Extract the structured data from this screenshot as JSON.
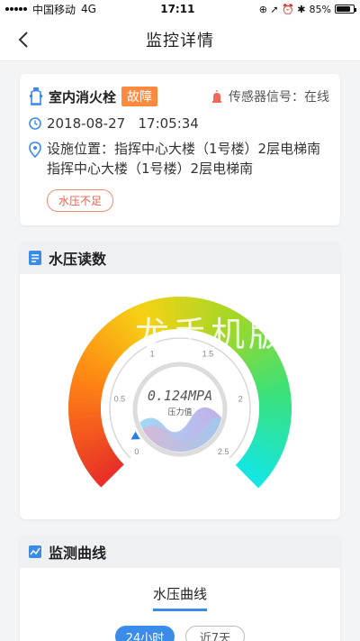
{
  "status_bar": {
    "carrier": "中国移动",
    "network": "4G",
    "time": "17:11",
    "battery": "85%",
    "battery_level": 0.85
  },
  "nav": {
    "title": "监控详情"
  },
  "device": {
    "name": "室内消火栓",
    "status_badge": "故障",
    "sensor_label": "传感器信号：在线",
    "datetime": "2018-08-27   17:05:34",
    "location": "设施位置：指挥中心大楼（1号楼）2层电梯南指挥中心大楼（1号楼）2层电梯南",
    "alert_tag": "水压不足"
  },
  "pressure_section": {
    "title": "水压读数",
    "reading": "0.124MPA",
    "reading_label": "压力值",
    "value": 0.124,
    "scale_labels": [
      "0",
      "0.5",
      "1",
      "1.5",
      "2",
      "2.5"
    ],
    "watermark": "龙手机版 I"
  },
  "curve_section": {
    "title": "监测曲线",
    "tab": "水压曲线",
    "ranges": [
      "24小时",
      "近7天"
    ],
    "active_range": "24小时"
  }
}
